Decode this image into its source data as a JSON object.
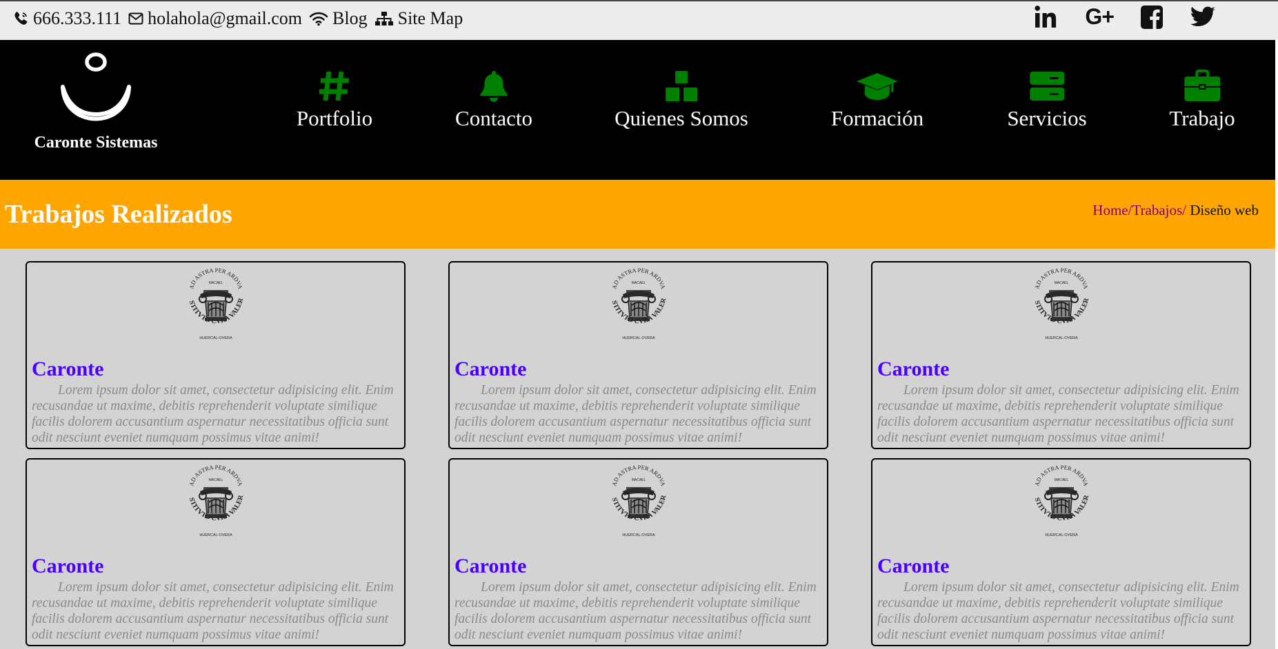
{
  "topbar": {
    "phone": "666.333.111",
    "email": "holahola@gmail.com",
    "blog": "Blog",
    "sitemap": "Site Map",
    "social_icons": [
      "linkedin-icon",
      "google-plus-icon",
      "facebook-icon",
      "twitter-icon"
    ],
    "gplus_text": "G+"
  },
  "header": {
    "brand": "Caronte Sistemas",
    "nav": [
      {
        "label": "Portfolio",
        "icon": "hashtag-icon"
      },
      {
        "label": "Contacto",
        "icon": "bell-icon"
      },
      {
        "label": "Quienes Somos",
        "icon": "cubes-icon"
      },
      {
        "label": "Formación",
        "icon": "graduation-cap-icon"
      },
      {
        "label": "Servicios",
        "icon": "server-icon"
      },
      {
        "label": "Trabajo",
        "icon": "briefcase-icon"
      }
    ],
    "icon_color": "#008000"
  },
  "band": {
    "title": "Trabajos Realizados",
    "breadcrumb": {
      "home": "Home/",
      "trabajos": "Trabajos/",
      "current": " Diseño web"
    }
  },
  "cards": [
    {
      "title": "Caronte",
      "text": "Lorem ipsum dolor sit amet, consectetur adipisicing elit. Enim recusandae ut maxime, debitis reprehenderit voluptate similique facilis dolorem accusantium aspernatur necessitatibus officia sunt odit nesciunt eveniet numquam possimus vitae animi!"
    },
    {
      "title": "Caronte",
      "text": "Lorem ipsum dolor sit amet, consectetur adipisicing elit. Enim recusandae ut maxime, debitis reprehenderit voluptate similique facilis dolorem accusantium aspernatur necessitatibus officia sunt odit nesciunt eveniet numquam possimus vitae animi!"
    },
    {
      "title": "Caronte",
      "text": "Lorem ipsum dolor sit amet, consectetur adipisicing elit. Enim recusandae ut maxime, debitis reprehenderit voluptate similique facilis dolorem accusantium aspernatur necessitatibus officia sunt odit nesciunt eveniet numquam possimus vitae animi!"
    },
    {
      "title": "Caronte",
      "text": "Lorem ipsum dolor sit amet, consectetur adipisicing elit. Enim recusandae ut maxime, debitis reprehenderit voluptate similique facilis dolorem accusantium aspernatur necessitatibus officia sunt odit nesciunt eveniet numquam possimus vitae animi!"
    },
    {
      "title": "Caronte",
      "text": "Lorem ipsum dolor sit amet, consectetur adipisicing elit. Enim recusandae ut maxime, debitis reprehenderit voluptate similique facilis dolorem accusantium aspernatur necessitatibus officia sunt odit nesciunt eveniet numquam possimus vitae animi!"
    },
    {
      "title": "Caronte",
      "text": "Lorem ipsum dolor sit amet, consectetur adipisicing elit. Enim recusandae ut maxime, debitis reprehenderit voluptate similique facilis dolorem accusantium aspernatur necessitatibus officia sunt odit nesciunt eveniet numquam possimus vitae animi!"
    }
  ],
  "seal": {
    "top_text": "AD ASTRA PER ARDVA",
    "small_text": "MACAEL",
    "bottom_text": "INSTITVTO CVRA VALERA",
    "sub_text": "HUERCAL-OVERA"
  }
}
